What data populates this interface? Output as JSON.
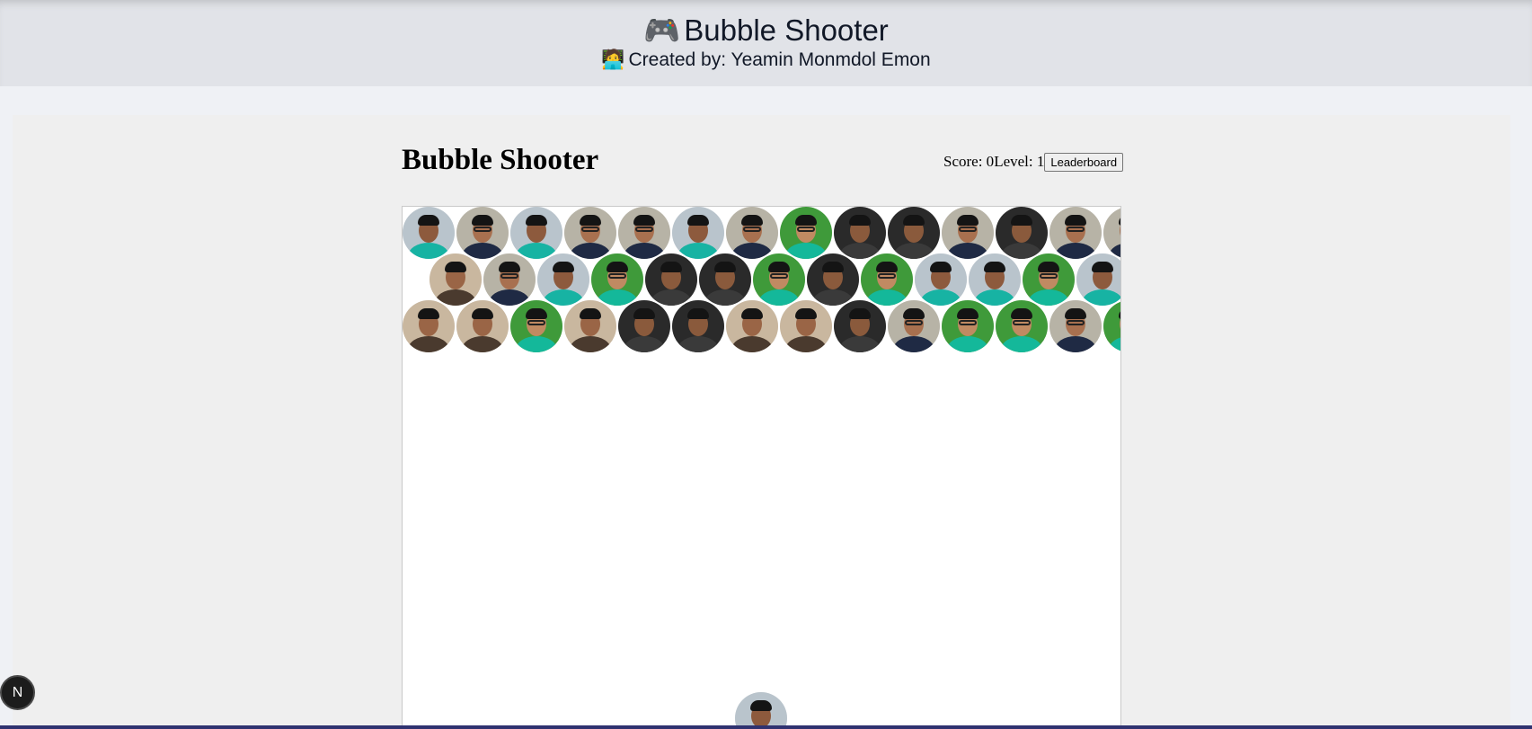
{
  "header": {
    "title_emoji": "🎮",
    "title": "Bubble Shooter",
    "subtitle_emoji": "🧑‍💻",
    "subtitle": "Created by: Yeamin Monmdol Emon"
  },
  "game": {
    "title": "Bubble Shooter",
    "score_text": "Score: 0",
    "level_text": "Level: 1",
    "leaderboard_label": "Leaderboard",
    "score": 0,
    "level": 1
  },
  "bubble_types": {
    "A": {
      "bg": "#b9c4cc",
      "shirt": "#17b3a3",
      "face": "#8d5a3d",
      "glasses": false
    },
    "B": {
      "bg": "#b7b3a6",
      "shirt": "#1f2a44",
      "face": "#a8704f",
      "glasses": true
    },
    "C": {
      "bg": "#3f9a3a",
      "shirt": "#14b89a",
      "face": "#c08a62",
      "glasses": true
    },
    "D": {
      "bg": "#2a2a2a",
      "shirt": "#3a3a3a",
      "face": "#8a5a3c",
      "glasses": false
    },
    "E": {
      "bg": "#c9b79f",
      "shirt": "#4a3a2e",
      "face": "#9a6546",
      "glasses": false
    }
  },
  "grid": {
    "rows": [
      [
        "A",
        "B",
        "A",
        "B",
        "B",
        "A",
        "B",
        "C",
        "D",
        "D",
        "B",
        "D",
        "B",
        "B"
      ],
      [
        "E",
        "B",
        "A",
        "C",
        "D",
        "D",
        "C",
        "D",
        "C",
        "A",
        "A",
        "C",
        "A"
      ],
      [
        "E",
        "E",
        "C",
        "E",
        "D",
        "D",
        "E",
        "E",
        "D",
        "B",
        "C",
        "C",
        "B",
        "C"
      ]
    ]
  },
  "next_bubble": "A",
  "dev_badge": {
    "label": "N"
  }
}
